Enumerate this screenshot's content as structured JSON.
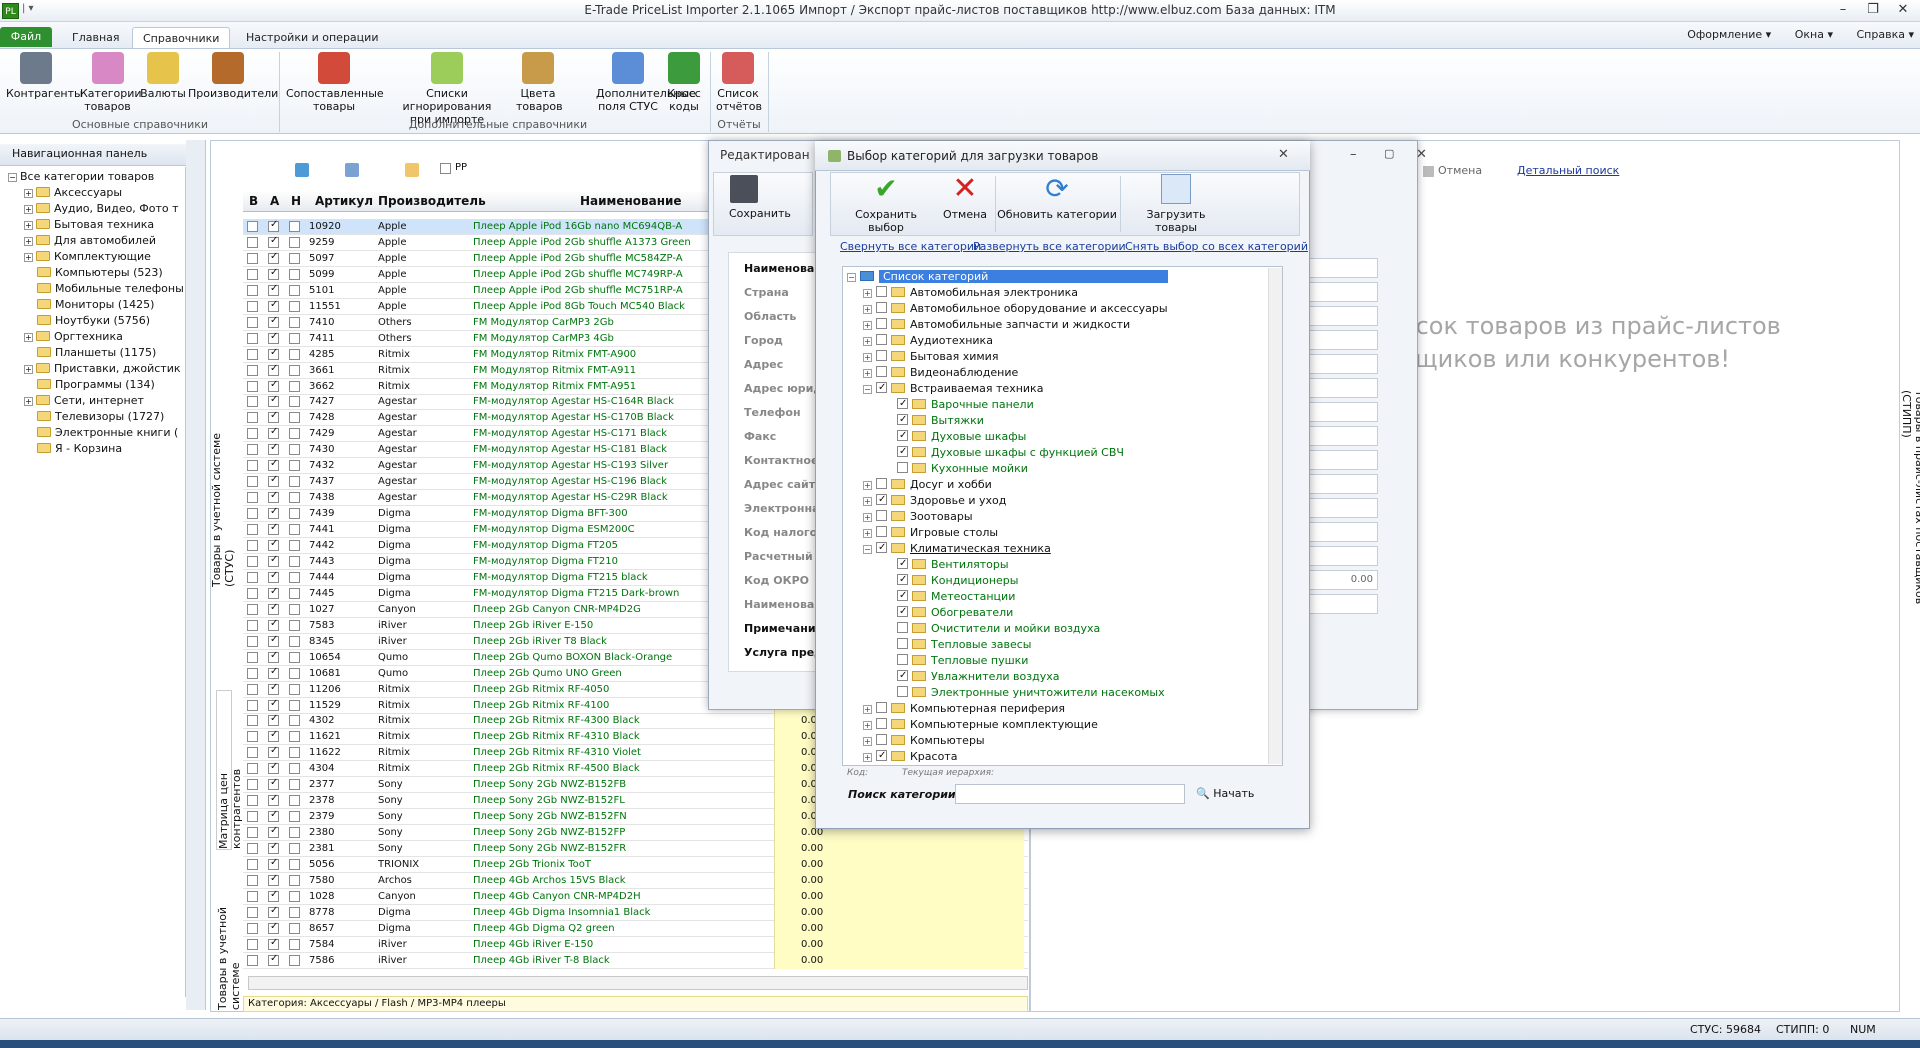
{
  "titlebar": {
    "title": "E-Trade PriceList Importer 2.1.1065    Импорт / Экспорт прайс-листов поставщиков    http://www.elbuz.com    База данных: ITM",
    "app_icon": "PL"
  },
  "menu": {
    "file": "Файл",
    "tabs": [
      "Главная",
      "Справочники",
      "Настройки и операции"
    ],
    "active_tab": "Справочники",
    "right": [
      "Оформление",
      "Окна",
      "Справка"
    ]
  },
  "ribbon": {
    "buttons": [
      "Контрагенты",
      "Категории\nтоваров",
      "Валюты",
      "Производители",
      "Сопоставленные\nтовары",
      "Списки игнорирования\nпри импорте",
      "Цвета\nтоваров",
      "Дополнительные\nполя СТУС",
      "Кросс\nкоды",
      "Список\nотчётов"
    ],
    "groups": [
      "Основные справочники",
      "Дополнительные справочники",
      "Отчёты"
    ]
  },
  "nav": {
    "title": "Навигационная панель",
    "items": [
      {
        "label": "Все категории товаров",
        "level": 0
      },
      {
        "label": "Аксессуары",
        "level": 1,
        "exp": true
      },
      {
        "label": "Аудио, Видео, Фото т",
        "level": 1,
        "exp": true
      },
      {
        "label": "Бытовая техника",
        "level": 1,
        "exp": true
      },
      {
        "label": "Для автомобилей",
        "level": 1,
        "exp": true
      },
      {
        "label": "Комплектующие",
        "level": 1,
        "exp": true
      },
      {
        "label": "Компьютеры (523)",
        "level": 1
      },
      {
        "label": "Мобильные телефоны",
        "level": 1
      },
      {
        "label": "Мониторы (1425)",
        "level": 1
      },
      {
        "label": "Ноутбуки (5756)",
        "level": 1
      },
      {
        "label": "Оргтехника",
        "level": 1,
        "exp": true
      },
      {
        "label": "Планшеты (1175)",
        "level": 1
      },
      {
        "label": "Приставки, джойстик",
        "level": 1,
        "exp": true
      },
      {
        "label": "Программы (134)",
        "level": 1
      },
      {
        "label": "Сети, интернет",
        "level": 1,
        "exp": true
      },
      {
        "label": "Телевизоры (1727)",
        "level": 1
      },
      {
        "label": "Электронные книги (",
        "level": 1
      },
      {
        "label": "Я - Корзина",
        "level": 1
      }
    ]
  },
  "grid": {
    "side_tab": "Товары в учетной системе (СТУС)",
    "side_tab2": "Матрица цен контрагентов",
    "side_tab3": "Товары в учетной системе",
    "toolbar_pp": "PP",
    "headers": [
      "В",
      "А",
      "Н",
      "Артикул",
      "Производитель",
      "Наименование"
    ],
    "rows": [
      [
        "10920",
        "Apple",
        "Плеер Apple iPod 16Gb nano MC694QB-A"
      ],
      [
        "9259",
        "Apple",
        "Плеер Apple iPod 2Gb shuffle A1373 Green"
      ],
      [
        "5097",
        "Apple",
        "Плеер Apple iPod 2Gb shuffle MC584ZP-A"
      ],
      [
        "5099",
        "Apple",
        "Плеер Apple iPod 2Gb shuffle MC749RP-A"
      ],
      [
        "5101",
        "Apple",
        "Плеер Apple iPod 2Gb shuffle MC751RP-A"
      ],
      [
        "11551",
        "Apple",
        "Плеер Apple iPod 8Gb Touch MC540 Black"
      ],
      [
        "7410",
        "Others",
        "FM Модулятор CarMP3 2Gb"
      ],
      [
        "7411",
        "Others",
        "FM Модулятор CarMP3 4Gb"
      ],
      [
        "4285",
        "Ritmix",
        "FM Модулятор Ritmix FMT-A900"
      ],
      [
        "3661",
        "Ritmix",
        "FM Модулятор Ritmix FMT-A911"
      ],
      [
        "3662",
        "Ritmix",
        "FM Модулятор Ritmix FMT-A951"
      ],
      [
        "7427",
        "Agestar",
        "FM-модулятор Agestar HS-C164R Black"
      ],
      [
        "7428",
        "Agestar",
        "FM-модулятор Agestar HS-C170B Black"
      ],
      [
        "7429",
        "Agestar",
        "FM-модулятор Agestar HS-C171 Black"
      ],
      [
        "7430",
        "Agestar",
        "FM-модулятор Agestar HS-C181 Black"
      ],
      [
        "7432",
        "Agestar",
        "FM-модулятор Agestar HS-C193 Silver"
      ],
      [
        "7437",
        "Agestar",
        "FM-модулятор Agestar HS-C196 Black"
      ],
      [
        "7438",
        "Agestar",
        "FM-модулятор Agestar HS-C29R Black"
      ],
      [
        "7439",
        "Digma",
        "FM-модулятор Digma BFT-300"
      ],
      [
        "7441",
        "Digma",
        "FM-модулятор Digma ESM200C"
      ],
      [
        "7442",
        "Digma",
        "FM-модулятор Digma FT205"
      ],
      [
        "7443",
        "Digma",
        "FM-модулятор Digma FT210"
      ],
      [
        "7444",
        "Digma",
        "FM-модулятор Digma FT215 black"
      ],
      [
        "7445",
        "Digma",
        "FM-модулятор Digma FT215 Dark-brown"
      ],
      [
        "1027",
        "Canyon",
        "Плеер 2Gb Canyon CNR-MP4D2G"
      ],
      [
        "7583",
        "iRiver",
        "Плеер 2Gb iRiver E-150"
      ],
      [
        "8345",
        "iRiver",
        "Плеер 2Gb iRiver T8 Black"
      ],
      [
        "10654",
        "Qumo",
        "Плеер 2Gb Qumo BOXON Black-Orange"
      ],
      [
        "10681",
        "Qumo",
        "Плеер 2Gb Qumo UNO Green"
      ],
      [
        "11206",
        "Ritmix",
        "Плеер 2Gb Ritmix RF-4050"
      ],
      [
        "11529",
        "Ritmix",
        "Плеер 2Gb Ritmix RF-4100"
      ],
      [
        "4302",
        "Ritmix",
        "Плеер 2Gb Ritmix RF-4300 Black"
      ],
      [
        "11621",
        "Ritmix",
        "Плеер 2Gb Ritmix RF-4310 Black"
      ],
      [
        "11622",
        "Ritmix",
        "Плеер 2Gb Ritmix RF-4310 Violet"
      ],
      [
        "4304",
        "Ritmix",
        "Плеер 2Gb Ritmix RF-4500 Black"
      ],
      [
        "2377",
        "Sony",
        "Плеер Sony 2Gb NWZ-B152FB"
      ],
      [
        "2378",
        "Sony",
        "Плеер Sony 2Gb NWZ-B152FL"
      ],
      [
        "2379",
        "Sony",
        "Плеер Sony 2Gb NWZ-B152FN"
      ],
      [
        "2380",
        "Sony",
        "Плеер Sony 2Gb NWZ-B152FP"
      ],
      [
        "2381",
        "Sony",
        "Плеер Sony 2Gb NWZ-B152FR"
      ],
      [
        "5056",
        "TRIONIX",
        "Плеер 2Gb Trionix TooT"
      ],
      [
        "7580",
        "Archos",
        "Плеер 4Gb Archos 15VS Black"
      ],
      [
        "1028",
        "Canyon",
        "Плеер 4Gb Canyon CNR-MP4D2H"
      ],
      [
        "8778",
        "Digma",
        "Плеер 4Gb Digma Insomnia1 Black"
      ],
      [
        "8657",
        "Digma",
        "Плеер 4Gb Digma Q2 green"
      ],
      [
        "7584",
        "iRiver",
        "Плеер 4Gb iRiver E-150"
      ],
      [
        "7586",
        "iRiver",
        "Плеер 4Gb iRiver T-8 Black"
      ]
    ],
    "price_value": "0.00",
    "status_category": "Категория: Аксессуары / Flash / MP3-MP4 плееры"
  },
  "edit_dialog": {
    "title": "Редактирован",
    "save": "Сохранить",
    "fields": [
      "Наименован",
      "Страна",
      "Область",
      "Город",
      "Адрес",
      "Адрес юрид",
      "Телефон",
      "Факс",
      "Контактное",
      "Адрес сайта",
      "Электронна",
      "Код налогов",
      "Расчетный с",
      "Код ОКРО",
      "Наименован",
      "Примечание",
      "Услуга пред"
    ],
    "value": "0.00"
  },
  "right": {
    "cancel": "Отмена",
    "detail_search": "Детальный поиск",
    "big_text_1": "исок товаров из прайс-листов",
    "big_text_2": "щиков или конкурентов!",
    "side_tab": "Товары в прайс-листах поставщиков (СТИПП)"
  },
  "cat_dialog": {
    "title": "Выбор категорий для загрузки товаров",
    "toolbar": [
      "Сохранить выбор",
      "Отмена",
      "Обновить категории",
      "Загрузить товары"
    ],
    "links": [
      "Свернуть все категории",
      "Развернуть все категории",
      "Снять выбор со всех категорий"
    ],
    "root": "Список категорий",
    "items": [
      {
        "label": "Автомобильная электроника",
        "level": 1,
        "checked": false,
        "exp": "+"
      },
      {
        "label": "Автомобильное оборудование и аксессуары",
        "level": 1,
        "checked": false,
        "exp": "+"
      },
      {
        "label": "Автомобильные запчасти и жидкости",
        "level": 1,
        "checked": false,
        "exp": "+"
      },
      {
        "label": "Аудиотехника",
        "level": 1,
        "checked": false,
        "exp": "+"
      },
      {
        "label": "Бытовая химия",
        "level": 1,
        "checked": false,
        "exp": "+"
      },
      {
        "label": "Видеонаблюдение",
        "level": 1,
        "checked": false,
        "exp": "+"
      },
      {
        "label": "Встраиваемая техника",
        "level": 1,
        "checked": true,
        "exp": "-"
      },
      {
        "label": "Варочные панели",
        "level": 2,
        "checked": true
      },
      {
        "label": "Вытяжки",
        "level": 2,
        "checked": true
      },
      {
        "label": "Духовые шкафы",
        "level": 2,
        "checked": true
      },
      {
        "label": "Духовые шкафы с функцией СВЧ",
        "level": 2,
        "checked": true
      },
      {
        "label": "Кухонные мойки",
        "level": 2,
        "checked": false
      },
      {
        "label": "Досуг и хобби",
        "level": 1,
        "checked": false,
        "exp": "+"
      },
      {
        "label": "Здоровье и уход",
        "level": 1,
        "checked": true,
        "exp": "+"
      },
      {
        "label": "Зоотовары",
        "level": 1,
        "checked": false,
        "exp": "+"
      },
      {
        "label": "Игровые столы",
        "level": 1,
        "checked": false,
        "exp": "+"
      },
      {
        "label": "Климатическая техника",
        "level": 1,
        "checked": true,
        "exp": "-",
        "underline": true
      },
      {
        "label": "Вентиляторы",
        "level": 2,
        "checked": true
      },
      {
        "label": "Кондиционеры",
        "level": 2,
        "checked": true
      },
      {
        "label": "Метеостанции",
        "level": 2,
        "checked": true
      },
      {
        "label": "Обогреватели",
        "level": 2,
        "checked": true
      },
      {
        "label": "Очистители и мойки воздуха",
        "level": 2,
        "checked": false
      },
      {
        "label": "Тепловые завесы",
        "level": 2,
        "checked": false
      },
      {
        "label": "Тепловые пушки",
        "level": 2,
        "checked": false
      },
      {
        "label": "Увлажнители воздуха",
        "level": 2,
        "checked": true
      },
      {
        "label": "Электронные уничтожители насекомых",
        "level": 2,
        "checked": false
      },
      {
        "label": "Компьютерная периферия",
        "level": 1,
        "checked": false,
        "exp": "+"
      },
      {
        "label": "Компьютерные комплектующие",
        "level": 1,
        "checked": false,
        "exp": "+"
      },
      {
        "label": "Компьютеры",
        "level": 1,
        "checked": false,
        "exp": "+"
      },
      {
        "label": "Красота",
        "level": 1,
        "checked": true,
        "exp": "+"
      }
    ],
    "code_label": "Код:",
    "hier_label": "Текущая иерархия:",
    "search_label": "Поиск категории:",
    "search_value": "",
    "search_button": "Начать"
  },
  "statusbar": {
    "stus": "СТУС: 59684",
    "stipp": "СТИПП: 0",
    "num": "NUM"
  },
  "colors": {
    "green_text": "#00740d",
    "file_tab": "#2e8f2e",
    "link": "#1b3b9c"
  }
}
